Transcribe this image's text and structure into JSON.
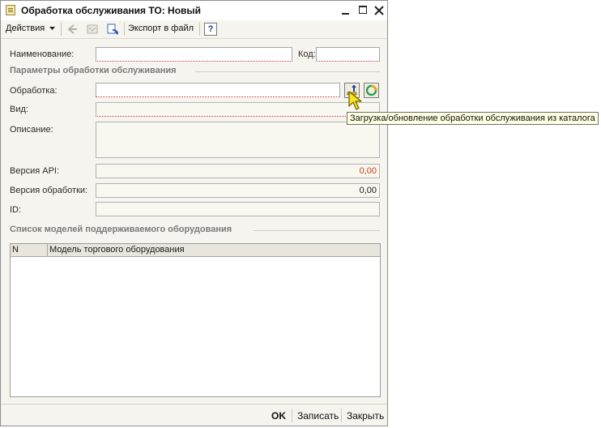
{
  "window": {
    "title": "Обработка обслуживания ТО: Новый"
  },
  "toolbar": {
    "actions_label": "Действия",
    "export_label": "Экспорт в файл",
    "help_label": "?"
  },
  "form": {
    "name_label": "Наименование:",
    "name_value": "",
    "code_label": "Код:",
    "code_value": "",
    "params_section": "Параметры обработки обслуживания",
    "processing_label": "Обработка:",
    "processing_value": "",
    "type_label": "Вид:",
    "type_value": "",
    "description_label": "Описание:",
    "description_value": "",
    "api_version_label": "Версия API:",
    "api_version_value": "0,00",
    "processing_version_label": "Версия обработки:",
    "processing_version_value": "0,00",
    "id_label": "ID:",
    "id_value": ""
  },
  "tooltip": {
    "text": "Загрузка/обновление обработки обслуживания из каталога"
  },
  "models_section": {
    "title": "Список моделей поддерживаемого оборудования",
    "columns": [
      "N",
      "Модель торгового оборудования"
    ],
    "rows": []
  },
  "footer": {
    "ok_label": "OK",
    "save_label": "Записать",
    "close_label": "Закрыть"
  },
  "colors": {
    "window_bg": "#f5f4ee",
    "required_underline": "#c23b3b",
    "api_version_value": "#c8401e",
    "tooltip_bg": "#ffffe1"
  }
}
